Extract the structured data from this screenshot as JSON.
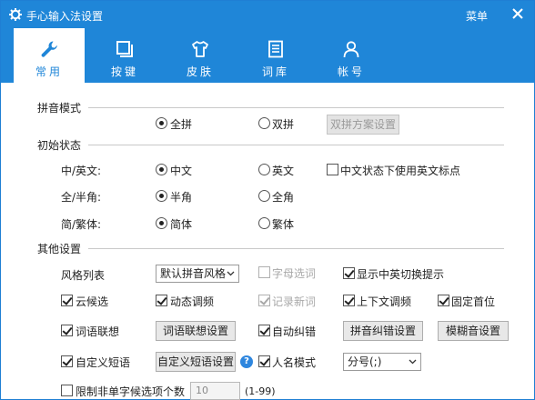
{
  "window": {
    "title": "手心输入法设置",
    "menu_label": "菜单"
  },
  "tabs": [
    {
      "label": "常用",
      "icon": "wrench-icon",
      "active": true
    },
    {
      "label": "按键",
      "icon": "keyboard-icon",
      "active": false
    },
    {
      "label": "皮肤",
      "icon": "shirt-icon",
      "active": false
    },
    {
      "label": "词库",
      "icon": "document-icon",
      "active": false
    },
    {
      "label": "帐号",
      "icon": "user-icon",
      "active": false
    }
  ],
  "sections": {
    "pinyin_mode": {
      "title": "拼音模式",
      "full_pinyin": "全拼",
      "double_pinyin": "双拼",
      "double_scheme_button": "双拼方案设置",
      "selected": "全拼"
    },
    "initial_state": {
      "title": "初始状态",
      "cn_en": {
        "label": "中/英文:",
        "opt1": "中文",
        "opt2": "英文",
        "extra": "中文状态下使用英文标点"
      },
      "width": {
        "label": "全/半角:",
        "opt1": "半角",
        "opt2": "全角"
      },
      "script": {
        "label": "简/繁体:",
        "opt1": "简体",
        "opt2": "繁体"
      }
    },
    "other": {
      "title": "其他设置",
      "style_list_label": "风格列表",
      "style_select_value": "默认拼音风格",
      "letter_select": "字母选词",
      "show_cn_en_hint": "显示中英切换提示",
      "cloud_candidate": "云候选",
      "dynamic_freq": "动态调频",
      "record_new_words": "记录新词",
      "context_freq": "上下文调频",
      "fix_first": "固定首位",
      "word_association": "词语联想",
      "word_association_button": "词语联想设置",
      "auto_correct": "自动纠错",
      "pinyin_correct_button": "拼音纠错设置",
      "fuzzy_button": "模糊音设置",
      "custom_phrase": "自定义短语",
      "custom_phrase_button": "自定义短语设置",
      "help_glyph": "?",
      "name_mode": "人名模式",
      "name_mode_select": "分号(;)",
      "limit_candidates": "限制非单字候选项个数",
      "limit_value": "10",
      "limit_range": "(1-99)"
    }
  },
  "colors": {
    "accent": "#1f86d8",
    "help": "#2e86de"
  }
}
